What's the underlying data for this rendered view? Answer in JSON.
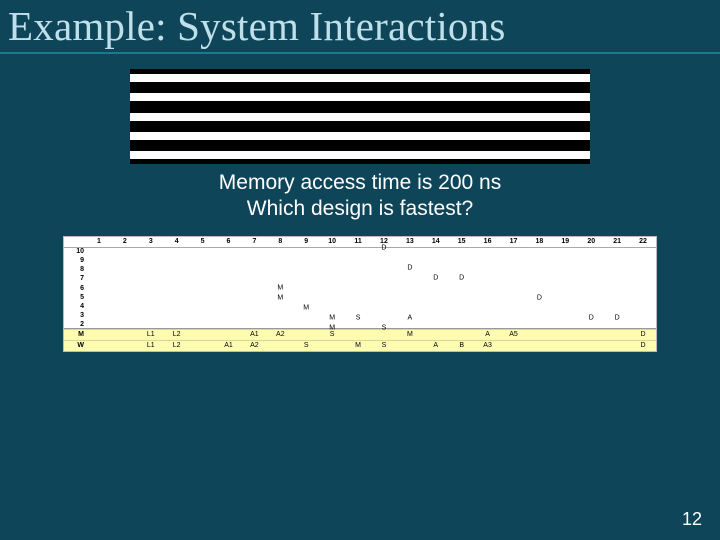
{
  "title": "Example: System Interactions",
  "midtext": {
    "line1": "Memory access time is 200 ns",
    "line2": "Which design is fastest?"
  },
  "page_number": "12",
  "chart_data": {
    "type": "scatter",
    "x_headers": [
      "1",
      "2",
      "3",
      "4",
      "5",
      "6",
      "7",
      "8",
      "9",
      "10",
      "11",
      "12",
      "13",
      "14",
      "15",
      "16",
      "17",
      "18",
      "19",
      "20",
      "21",
      "22"
    ],
    "y_labels": [
      "10",
      "9",
      "8",
      "7",
      "6",
      "5",
      "4",
      "3",
      "2"
    ],
    "markers": [
      {
        "x": 12,
        "y": 10,
        "label": "D"
      },
      {
        "x": 13,
        "y": 8,
        "label": "D"
      },
      {
        "x": 14,
        "y": 7,
        "label": "D"
      },
      {
        "x": 15,
        "y": 7,
        "label": "D"
      },
      {
        "x": 8,
        "y": 6,
        "label": "M"
      },
      {
        "x": 18,
        "y": 5,
        "label": "D"
      },
      {
        "x": 8,
        "y": 5,
        "label": "M"
      },
      {
        "x": 9,
        "y": 4,
        "label": "M"
      },
      {
        "x": 10,
        "y": 3,
        "label": "M"
      },
      {
        "x": 11,
        "y": 3,
        "label": "S"
      },
      {
        "x": 13,
        "y": 3,
        "label": "A"
      },
      {
        "x": 20,
        "y": 3,
        "label": "D"
      },
      {
        "x": 21,
        "y": 3,
        "label": "D"
      },
      {
        "x": 10,
        "y": 2,
        "label": "M"
      },
      {
        "x": 12,
        "y": 2,
        "label": "S"
      }
    ],
    "bottom_rows": [
      {
        "label": "M",
        "cells": [
          "",
          "",
          "L1",
          "L2",
          "",
          "",
          "A1",
          "A2",
          "",
          "S",
          "",
          "",
          "M",
          "",
          "",
          "A",
          "A5",
          "",
          "",
          "",
          "",
          "D"
        ]
      },
      {
        "label": "W",
        "cells": [
          "",
          "",
          "L1",
          "L2",
          "",
          "A1",
          "A2",
          "",
          "S",
          "",
          "M",
          "S",
          "",
          "A",
          "B",
          "A3",
          "",
          "",
          "",
          "",
          "",
          "D"
        ]
      }
    ]
  }
}
